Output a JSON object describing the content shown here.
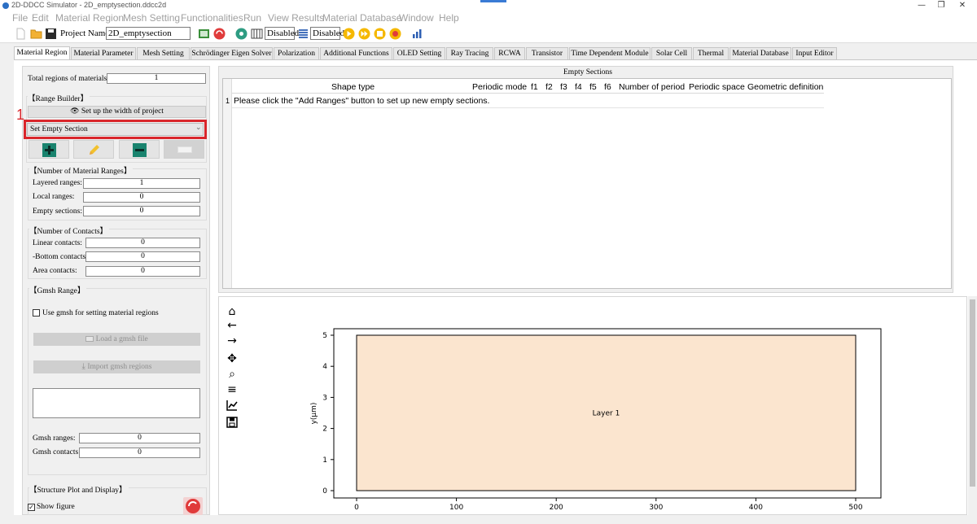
{
  "window": {
    "title": "2D-DDCC Simulator - 2D_emptysection.ddcc2d"
  },
  "menu": [
    "File",
    "Edit",
    "Material Region",
    "Mesh Setting",
    "Functionalities",
    "Run",
    "View Results",
    "Material Database",
    "Window",
    "Help"
  ],
  "toolbar": {
    "project_name_label": "Project Name:",
    "project_name_value": "2D_emptysection",
    "status_1": "Disabled",
    "status_2": "Disabled"
  },
  "tabs": [
    "Material Region",
    "Material Parameter",
    "Mesh Setting",
    "Schrödinger Eigen Solver",
    "Polarization",
    "Additional Functions",
    "OLED Setting",
    "Ray Tracing",
    "RCWA",
    "Transistor",
    "Time Dependent Module",
    "Solar Cell",
    "Thermal",
    "Material Database",
    "Input Editor"
  ],
  "left": {
    "total_regions_label": "Total regions of materials:",
    "total_regions_value": "1",
    "range_builder_title": "【Range Builder】",
    "setup_width_button": "Set up the width of project",
    "section_select_value": "Set Empty Section",
    "annotation_number": "1",
    "num_ranges_title": "【Number of Material Ranges】",
    "layered_label": "Layered ranges:",
    "layered_value": "1",
    "local_label": "Local ranges:",
    "local_value": "0",
    "empty_label": "Empty sections:",
    "empty_value": "0",
    "num_contacts_title": "【Number of Contacts】",
    "linear_label": "Linear contacts:",
    "linear_value": "0",
    "bottom_label": "-Bottom contacts:",
    "bottom_value": "0",
    "area_label": "Area contacts:",
    "area_value": "0",
    "gmsh_title": "【Gmsh Range】",
    "gmsh_checkbox_label": "Use gmsh for setting material regions",
    "load_gmsh_button": "Load a gmsh file",
    "import_gmsh_button": "Import gmsh regions",
    "gmsh_ranges_label": "Gmsh ranges:",
    "gmsh_ranges_value": "0",
    "gmsh_contacts_label": "Gmsh contacts:",
    "gmsh_contacts_value": "0",
    "structure_title": "【Structure Plot and Display】",
    "show_figure_label": "Show figure"
  },
  "sections": {
    "title": "Empty Sections",
    "headers": [
      "Shape type",
      "Periodic mode",
      "f1",
      "f2",
      "f3",
      "f4",
      "f5",
      "f6",
      "Number of period",
      "Periodic space",
      "Geometric definition"
    ],
    "row_number": "1",
    "row_message": "Please click the \"Add Ranges\" button to set up new empty sections."
  },
  "plot_toolbar": [
    "home-icon",
    "back-arrow-icon",
    "forward-arrow-icon",
    "pan-icon",
    "zoom-icon",
    "configure-subplots-icon",
    "edit-axis-icon",
    "save-icon"
  ],
  "colors": {
    "layer_fill": "#fbe5cf",
    "annotation_red": "#d9262b",
    "accent_teal": "#19836e"
  },
  "chart_data": {
    "type": "area",
    "xlabel": "",
    "ylabel": "y(μm)",
    "xlim": [
      0,
      500
    ],
    "ylim": [
      0,
      5
    ],
    "x_ticks": [
      "0",
      "100",
      "200",
      "300",
      "400",
      "500"
    ],
    "y_ticks": [
      "0",
      "1",
      "2",
      "3",
      "4",
      "5"
    ],
    "regions": [
      {
        "name": "Layer 1",
        "x": [
          0,
          500
        ],
        "y": [
          0,
          5
        ],
        "color": "#fbe5cf"
      }
    ]
  }
}
